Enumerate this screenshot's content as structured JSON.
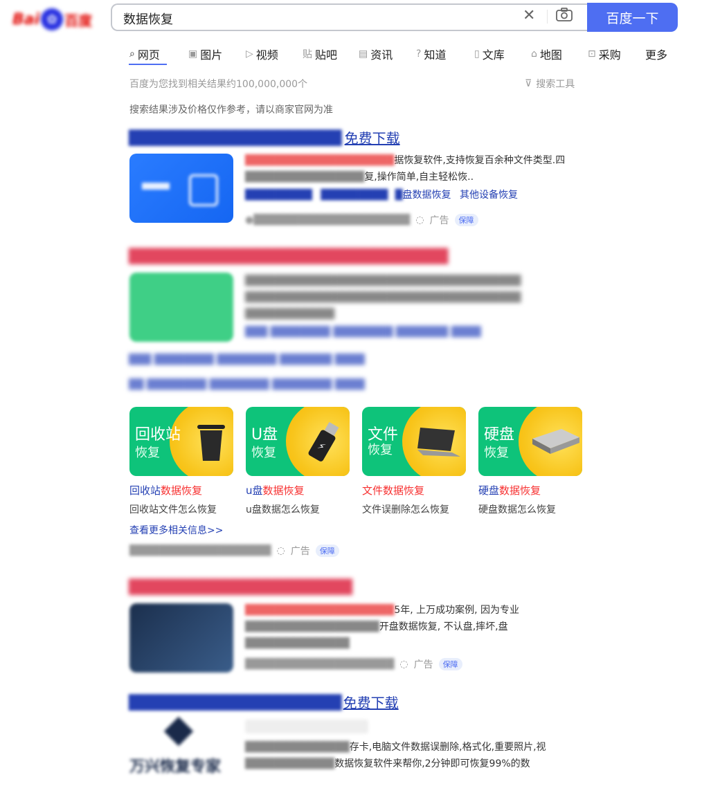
{
  "search": {
    "query": "数据恢复",
    "button_label": "百度一下"
  },
  "logo": {
    "left": "Bai",
    "right": "百度"
  },
  "tabs": [
    {
      "icon": "search-icon",
      "label": "网页"
    },
    {
      "icon": "image-icon",
      "label": "图片"
    },
    {
      "icon": "video-icon",
      "label": "视频"
    },
    {
      "icon": "tieba-icon",
      "label": "贴吧"
    },
    {
      "icon": "news-icon",
      "label": "资讯"
    },
    {
      "icon": "question-icon",
      "label": "知道"
    },
    {
      "icon": "doc-icon",
      "label": "文库"
    },
    {
      "icon": "map-icon",
      "label": "地图"
    },
    {
      "icon": "shop-icon",
      "label": "采购"
    },
    {
      "icon": "",
      "label": "更多"
    }
  ],
  "result_count": "百度为您找到相关结果约100,000,000个",
  "search_tools": "搜索工具",
  "price_notice": "搜索结果涉及价格仅作参考，请以商家官网为准",
  "results": {
    "r1": {
      "title_link": "免费下载",
      "desc_line1": "据恢复软件,支持恢复百余种文件类型.四",
      "desc_line2": "复,操作简单,自主轻松恢..",
      "link_a": "盘数据恢复",
      "link_b": "其他设备恢复"
    },
    "r3": {
      "desc_line1": "5年, 上万成功案例, 因为专业",
      "desc_line2": "开盘数据恢复, 不认盘,摔坏,盘"
    },
    "r4": {
      "title_link": "免费下载",
      "desc_line1": "存卡,电脑文件数据误删除,格式化,重要照片,视",
      "desc_line2": "数据恢复软件来帮你,2分钟即可恢复99%的数",
      "logo_text": "万兴恢复专家"
    }
  },
  "ad_label": "广告",
  "guarantee_label": "保障",
  "cards": [
    {
      "line1": "回收站",
      "line2": "恢复",
      "link_prefix": "回收站",
      "link_suffix": "数据恢复",
      "sub": "回收站文件怎么恢复",
      "icon": "trash-icon"
    },
    {
      "line1": "U盘",
      "line2": "恢复",
      "link_prefix": "u盘",
      "link_suffix": "数据恢复",
      "sub": "u盘数据怎么恢复",
      "icon": "usb-icon"
    },
    {
      "line1": "文件",
      "line2": "恢复",
      "link_prefix": "",
      "link_suffix": "文件数据恢复",
      "sub": "文件误删除怎么恢复",
      "icon": "laptop-icon"
    },
    {
      "line1": "硬盘",
      "line2": "恢复",
      "link_prefix": "硬盘",
      "link_suffix": "数据恢复",
      "sub": "硬盘数据怎么恢复",
      "icon": "harddisk-icon"
    }
  ],
  "more_info": "查看更多相关信息>>",
  "colors": {
    "accent": "#4e6ef2",
    "link": "#2440b3",
    "highlight": "#f73131",
    "card_green": "#0ec37a",
    "card_sun": "#f8c51c"
  }
}
